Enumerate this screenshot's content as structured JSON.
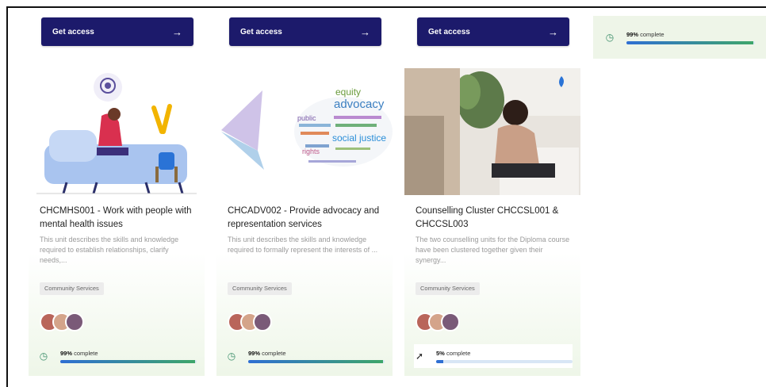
{
  "buttons": {
    "get_access_label": "Get access",
    "arrow": "→"
  },
  "top_right_progress": {
    "percent_label": "99%",
    "complete_label": "complete",
    "value": 0.99
  },
  "courses": [
    {
      "title": "CHCMHS001 - Work with people with mental health issues",
      "description": "This unit describes the skills and knowledge required to establish relationships, clarify needs,...",
      "tag": "Community Services",
      "progress_percent": "99%",
      "progress_text": "complete",
      "progress_value": 0.99,
      "status_icon": "clock-icon"
    },
    {
      "title": "CHCADV002 - Provide advocacy and representation services",
      "description": "This unit describes the skills and knowledge required to formally represent the interests of ...",
      "tag": "Community Services",
      "progress_percent": "99%",
      "progress_text": "complete",
      "progress_value": 0.99,
      "status_icon": "clock-icon",
      "word_cloud": [
        "equity",
        "advocacy",
        "social justice",
        "public",
        "rights"
      ]
    },
    {
      "title": "Counselling Cluster CHCCSL001 & CHCCSL003",
      "description": "The two counselling units for the Diploma course have been clustered together given their synergy...",
      "tag": "Community Services",
      "progress_percent": "5%",
      "progress_text": "complete",
      "progress_value": 0.05,
      "status_icon": "trend-icon"
    }
  ],
  "colors": {
    "button": "#1c1a6b",
    "progress_blue": "#2f6fd3",
    "progress_green": "#3ea66a",
    "card_tint": "#eef6e8"
  }
}
